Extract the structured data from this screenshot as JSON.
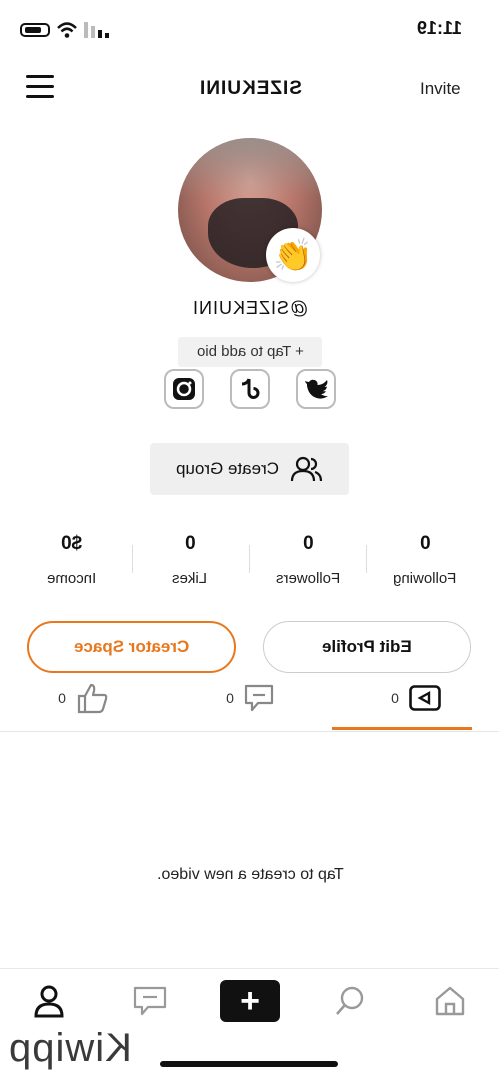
{
  "status_bar": {
    "time": "11:19"
  },
  "header": {
    "title": "SIZEKUINI",
    "invite_label": "Invite"
  },
  "profile": {
    "handle": "@SIZEKUINI",
    "badge_emoji": "👏",
    "bio_placeholder": "+ Tap to add bio",
    "social_icons": [
      "twitter-icon",
      "tiktok-icon",
      "instagram-icon"
    ]
  },
  "create_group_label": "Create Group",
  "stats": [
    {
      "value": "0",
      "label": "Following"
    },
    {
      "value": "0",
      "label": "Followers"
    },
    {
      "value": "0",
      "label": "Likes"
    },
    {
      "value": "$0",
      "label": "Income"
    }
  ],
  "buttons": {
    "edit_profile": "Edit Profile",
    "creator_space": "Creator Space"
  },
  "tabs": [
    {
      "icon": "video-icon",
      "count": "0"
    },
    {
      "icon": "comment-icon",
      "count": "0"
    },
    {
      "icon": "like-icon",
      "count": "0"
    }
  ],
  "empty_message": "Tap to create a new video.",
  "bottom_nav": [
    "profile-icon",
    "messages-icon",
    "plus-icon",
    "search-icon",
    "home-icon"
  ],
  "watermark": "Kiwipp",
  "colors": {
    "accent": "#e8781e",
    "dark": "#111111",
    "pill": "#efefef"
  }
}
